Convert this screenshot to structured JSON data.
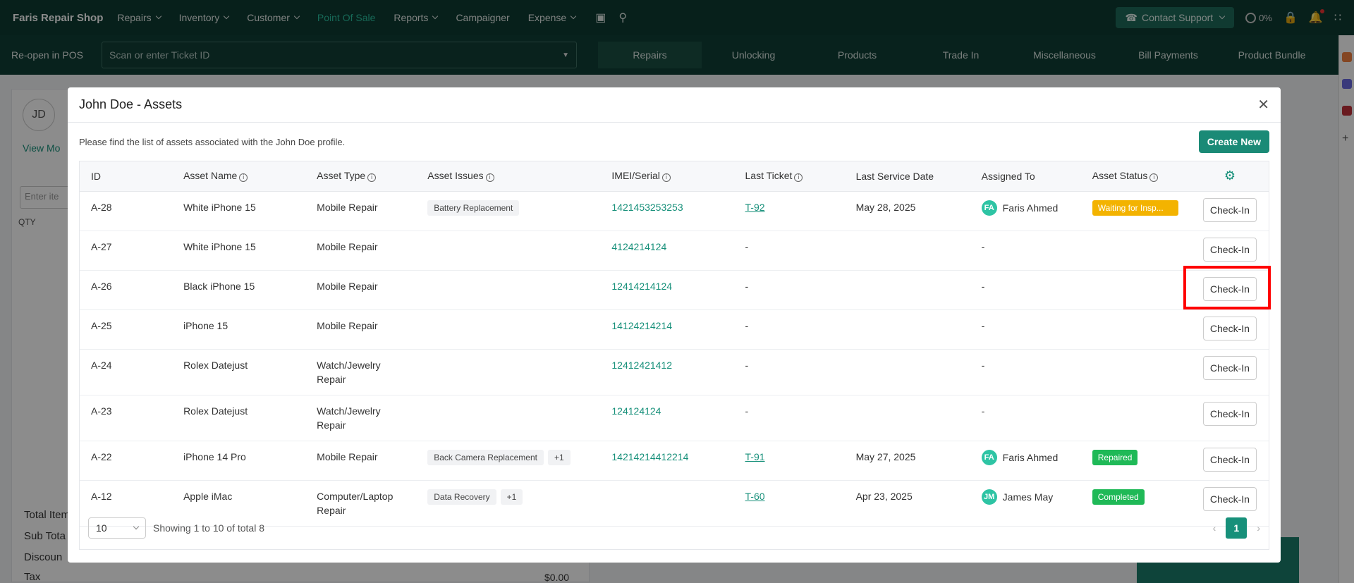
{
  "topnav": {
    "brand": "Faris Repair Shop",
    "items": [
      {
        "label": "Repairs",
        "caret": true,
        "active": false
      },
      {
        "label": "Inventory",
        "caret": true,
        "active": false
      },
      {
        "label": "Customer",
        "caret": true,
        "active": false
      },
      {
        "label": "Point Of Sale",
        "caret": false,
        "active": true
      },
      {
        "label": "Reports",
        "caret": true,
        "active": false
      },
      {
        "label": "Campaigner",
        "caret": false,
        "active": false
      },
      {
        "label": "Expense",
        "caret": true,
        "active": false
      }
    ],
    "support_label": "Contact Support",
    "percent": "0%"
  },
  "subbar": {
    "reopen_label": "Re-open in POS",
    "ticket_placeholder": "Scan or enter Ticket ID",
    "tabs": [
      "Repairs",
      "Unlocking",
      "Products",
      "Trade In",
      "Miscellaneous",
      "Bill Payments",
      "Product Bundle"
    ],
    "active_tab": "Repairs"
  },
  "background": {
    "avatar_initials": "JD",
    "view_more": "View Mo",
    "enter_item": "Enter ite",
    "qty_header": "QTY",
    "totals": [
      "Total Item",
      "Sub Tota",
      "Discoun",
      "Tax"
    ],
    "tax_value": "$0.00"
  },
  "modal": {
    "title": "John Doe - Assets",
    "description": "Please find the list of assets associated with the John Doe profile.",
    "create_button": "Create New",
    "columns": [
      "ID",
      "Asset Name",
      "Asset Type",
      "Asset Issues",
      "IMEI/Serial",
      "Last Ticket",
      "Last Service Date",
      "Assigned To",
      "Asset Status"
    ],
    "rows": [
      {
        "id": "A-28",
        "name": "White iPhone 15",
        "type": "Mobile Repair",
        "issues": [
          "Battery Replacement"
        ],
        "extra": "",
        "imei": "1421453253253",
        "ticket": "T-92",
        "date": "May 28, 2025",
        "assignee": "Faris Ahmed",
        "initials": "FA",
        "status": "Waiting for Insp...",
        "status_kind": "wait",
        "action": "Check-In"
      },
      {
        "id": "A-27",
        "name": "White iPhone 15",
        "type": "Mobile Repair",
        "issues": [],
        "extra": "",
        "imei": "4124214124",
        "ticket": "-",
        "date": "",
        "assignee": "-",
        "initials": "",
        "status": "",
        "status_kind": "",
        "action": "Check-In"
      },
      {
        "id": "A-26",
        "name": "Black iPhone 15",
        "type": "Mobile Repair",
        "issues": [],
        "extra": "",
        "imei": "12414214124",
        "ticket": "-",
        "date": "",
        "assignee": "-",
        "initials": "",
        "status": "",
        "status_kind": "",
        "action": "Check-In"
      },
      {
        "id": "A-25",
        "name": "iPhone 15",
        "type": "Mobile Repair",
        "issues": [],
        "extra": "",
        "imei": "14124214214",
        "ticket": "-",
        "date": "",
        "assignee": "-",
        "initials": "",
        "status": "",
        "status_kind": "",
        "action": "Check-In"
      },
      {
        "id": "A-24",
        "name": "Rolex Datejust",
        "type": "Watch/Jewelry Repair",
        "issues": [],
        "extra": "",
        "imei": "12412421412",
        "ticket": "-",
        "date": "",
        "assignee": "-",
        "initials": "",
        "status": "",
        "status_kind": "",
        "action": "Check-In"
      },
      {
        "id": "A-23",
        "name": "Rolex Datejust",
        "type": "Watch/Jewelry Repair",
        "issues": [],
        "extra": "",
        "imei": "124124124",
        "ticket": "-",
        "date": "",
        "assignee": "-",
        "initials": "",
        "status": "",
        "status_kind": "",
        "action": "Check-In"
      },
      {
        "id": "A-22",
        "name": "iPhone 14 Pro",
        "type": "Mobile Repair",
        "issues": [
          "Back Camera Replacement"
        ],
        "extra": "+1",
        "imei": "14214214412214",
        "ticket": "T-91",
        "date": "May 27, 2025",
        "assignee": "Faris Ahmed",
        "initials": "FA",
        "status": "Repaired",
        "status_kind": "rep",
        "action": "Check-In"
      },
      {
        "id": "A-12",
        "name": "Apple iMac",
        "type": "Computer/Laptop Repair",
        "issues": [
          "Data Recovery"
        ],
        "extra": "+1",
        "imei": "",
        "ticket": "T-60",
        "date": "Apr 23, 2025",
        "assignee": "James May",
        "initials": "JM",
        "status": "Completed",
        "status_kind": "comp",
        "action": "Check-In"
      }
    ],
    "footer": {
      "per_page": "10",
      "showing": "Showing 1 to 10 of total 8",
      "current_page": "1"
    }
  },
  "colors": {
    "brand_dark": "#0d3b32",
    "accent": "#17907a",
    "status_waiting": "#f3b300",
    "status_done": "#1fb957",
    "highlight": "#ff0000"
  }
}
